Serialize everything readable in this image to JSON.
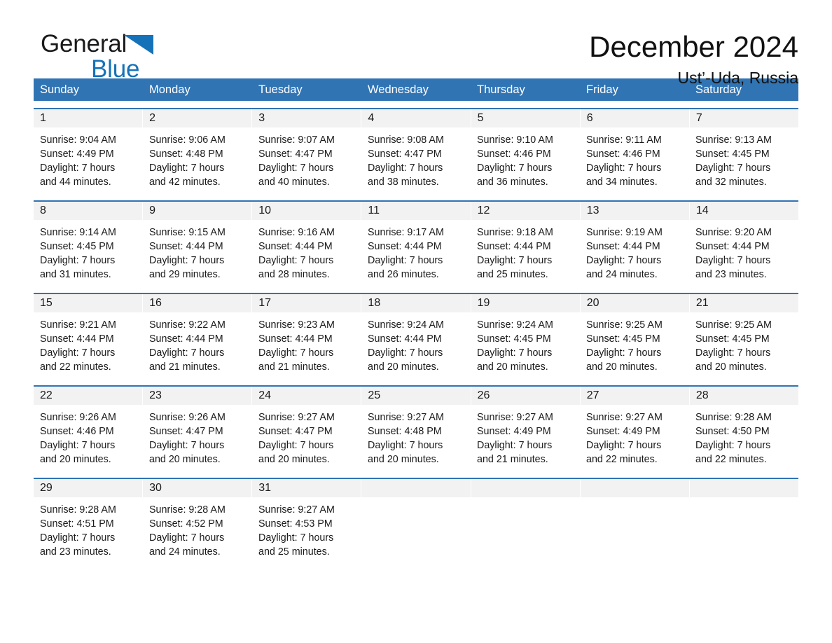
{
  "brand": {
    "word1": "General",
    "word2": "Blue",
    "triangle_color": "#1672b8",
    "word1_color": "#1a1a1a",
    "word2_color": "#1672b8"
  },
  "header": {
    "title": "December 2024",
    "subtitle": "Ust’-Uda, Russia"
  },
  "theme": {
    "header_blue": "#3074b4",
    "daynum_band": "#f2f2f2",
    "text": "#1a1a1a"
  },
  "weekdays": [
    "Sunday",
    "Monday",
    "Tuesday",
    "Wednesday",
    "Thursday",
    "Friday",
    "Saturday"
  ],
  "weeks": [
    [
      {
        "day": "1",
        "sunrise": "Sunrise: 9:04 AM",
        "sunset": "Sunset: 4:49 PM",
        "daylight1": "Daylight: 7 hours",
        "daylight2": "and 44 minutes."
      },
      {
        "day": "2",
        "sunrise": "Sunrise: 9:06 AM",
        "sunset": "Sunset: 4:48 PM",
        "daylight1": "Daylight: 7 hours",
        "daylight2": "and 42 minutes."
      },
      {
        "day": "3",
        "sunrise": "Sunrise: 9:07 AM",
        "sunset": "Sunset: 4:47 PM",
        "daylight1": "Daylight: 7 hours",
        "daylight2": "and 40 minutes."
      },
      {
        "day": "4",
        "sunrise": "Sunrise: 9:08 AM",
        "sunset": "Sunset: 4:47 PM",
        "daylight1": "Daylight: 7 hours",
        "daylight2": "and 38 minutes."
      },
      {
        "day": "5",
        "sunrise": "Sunrise: 9:10 AM",
        "sunset": "Sunset: 4:46 PM",
        "daylight1": "Daylight: 7 hours",
        "daylight2": "and 36 minutes."
      },
      {
        "day": "6",
        "sunrise": "Sunrise: 9:11 AM",
        "sunset": "Sunset: 4:46 PM",
        "daylight1": "Daylight: 7 hours",
        "daylight2": "and 34 minutes."
      },
      {
        "day": "7",
        "sunrise": "Sunrise: 9:13 AM",
        "sunset": "Sunset: 4:45 PM",
        "daylight1": "Daylight: 7 hours",
        "daylight2": "and 32 minutes."
      }
    ],
    [
      {
        "day": "8",
        "sunrise": "Sunrise: 9:14 AM",
        "sunset": "Sunset: 4:45 PM",
        "daylight1": "Daylight: 7 hours",
        "daylight2": "and 31 minutes."
      },
      {
        "day": "9",
        "sunrise": "Sunrise: 9:15 AM",
        "sunset": "Sunset: 4:44 PM",
        "daylight1": "Daylight: 7 hours",
        "daylight2": "and 29 minutes."
      },
      {
        "day": "10",
        "sunrise": "Sunrise: 9:16 AM",
        "sunset": "Sunset: 4:44 PM",
        "daylight1": "Daylight: 7 hours",
        "daylight2": "and 28 minutes."
      },
      {
        "day": "11",
        "sunrise": "Sunrise: 9:17 AM",
        "sunset": "Sunset: 4:44 PM",
        "daylight1": "Daylight: 7 hours",
        "daylight2": "and 26 minutes."
      },
      {
        "day": "12",
        "sunrise": "Sunrise: 9:18 AM",
        "sunset": "Sunset: 4:44 PM",
        "daylight1": "Daylight: 7 hours",
        "daylight2": "and 25 minutes."
      },
      {
        "day": "13",
        "sunrise": "Sunrise: 9:19 AM",
        "sunset": "Sunset: 4:44 PM",
        "daylight1": "Daylight: 7 hours",
        "daylight2": "and 24 minutes."
      },
      {
        "day": "14",
        "sunrise": "Sunrise: 9:20 AM",
        "sunset": "Sunset: 4:44 PM",
        "daylight1": "Daylight: 7 hours",
        "daylight2": "and 23 minutes."
      }
    ],
    [
      {
        "day": "15",
        "sunrise": "Sunrise: 9:21 AM",
        "sunset": "Sunset: 4:44 PM",
        "daylight1": "Daylight: 7 hours",
        "daylight2": "and 22 minutes."
      },
      {
        "day": "16",
        "sunrise": "Sunrise: 9:22 AM",
        "sunset": "Sunset: 4:44 PM",
        "daylight1": "Daylight: 7 hours",
        "daylight2": "and 21 minutes."
      },
      {
        "day": "17",
        "sunrise": "Sunrise: 9:23 AM",
        "sunset": "Sunset: 4:44 PM",
        "daylight1": "Daylight: 7 hours",
        "daylight2": "and 21 minutes."
      },
      {
        "day": "18",
        "sunrise": "Sunrise: 9:24 AM",
        "sunset": "Sunset: 4:44 PM",
        "daylight1": "Daylight: 7 hours",
        "daylight2": "and 20 minutes."
      },
      {
        "day": "19",
        "sunrise": "Sunrise: 9:24 AM",
        "sunset": "Sunset: 4:45 PM",
        "daylight1": "Daylight: 7 hours",
        "daylight2": "and 20 minutes."
      },
      {
        "day": "20",
        "sunrise": "Sunrise: 9:25 AM",
        "sunset": "Sunset: 4:45 PM",
        "daylight1": "Daylight: 7 hours",
        "daylight2": "and 20 minutes."
      },
      {
        "day": "21",
        "sunrise": "Sunrise: 9:25 AM",
        "sunset": "Sunset: 4:45 PM",
        "daylight1": "Daylight: 7 hours",
        "daylight2": "and 20 minutes."
      }
    ],
    [
      {
        "day": "22",
        "sunrise": "Sunrise: 9:26 AM",
        "sunset": "Sunset: 4:46 PM",
        "daylight1": "Daylight: 7 hours",
        "daylight2": "and 20 minutes."
      },
      {
        "day": "23",
        "sunrise": "Sunrise: 9:26 AM",
        "sunset": "Sunset: 4:47 PM",
        "daylight1": "Daylight: 7 hours",
        "daylight2": "and 20 minutes."
      },
      {
        "day": "24",
        "sunrise": "Sunrise: 9:27 AM",
        "sunset": "Sunset: 4:47 PM",
        "daylight1": "Daylight: 7 hours",
        "daylight2": "and 20 minutes."
      },
      {
        "day": "25",
        "sunrise": "Sunrise: 9:27 AM",
        "sunset": "Sunset: 4:48 PM",
        "daylight1": "Daylight: 7 hours",
        "daylight2": "and 20 minutes."
      },
      {
        "day": "26",
        "sunrise": "Sunrise: 9:27 AM",
        "sunset": "Sunset: 4:49 PM",
        "daylight1": "Daylight: 7 hours",
        "daylight2": "and 21 minutes."
      },
      {
        "day": "27",
        "sunrise": "Sunrise: 9:27 AM",
        "sunset": "Sunset: 4:49 PM",
        "daylight1": "Daylight: 7 hours",
        "daylight2": "and 22 minutes."
      },
      {
        "day": "28",
        "sunrise": "Sunrise: 9:28 AM",
        "sunset": "Sunset: 4:50 PM",
        "daylight1": "Daylight: 7 hours",
        "daylight2": "and 22 minutes."
      }
    ],
    [
      {
        "day": "29",
        "sunrise": "Sunrise: 9:28 AM",
        "sunset": "Sunset: 4:51 PM",
        "daylight1": "Daylight: 7 hours",
        "daylight2": "and 23 minutes."
      },
      {
        "day": "30",
        "sunrise": "Sunrise: 9:28 AM",
        "sunset": "Sunset: 4:52 PM",
        "daylight1": "Daylight: 7 hours",
        "daylight2": "and 24 minutes."
      },
      {
        "day": "31",
        "sunrise": "Sunrise: 9:27 AM",
        "sunset": "Sunset: 4:53 PM",
        "daylight1": "Daylight: 7 hours",
        "daylight2": "and 25 minutes."
      },
      {
        "day": "",
        "sunrise": "",
        "sunset": "",
        "daylight1": "",
        "daylight2": ""
      },
      {
        "day": "",
        "sunrise": "",
        "sunset": "",
        "daylight1": "",
        "daylight2": ""
      },
      {
        "day": "",
        "sunrise": "",
        "sunset": "",
        "daylight1": "",
        "daylight2": ""
      },
      {
        "day": "",
        "sunrise": "",
        "sunset": "",
        "daylight1": "",
        "daylight2": ""
      }
    ]
  ]
}
